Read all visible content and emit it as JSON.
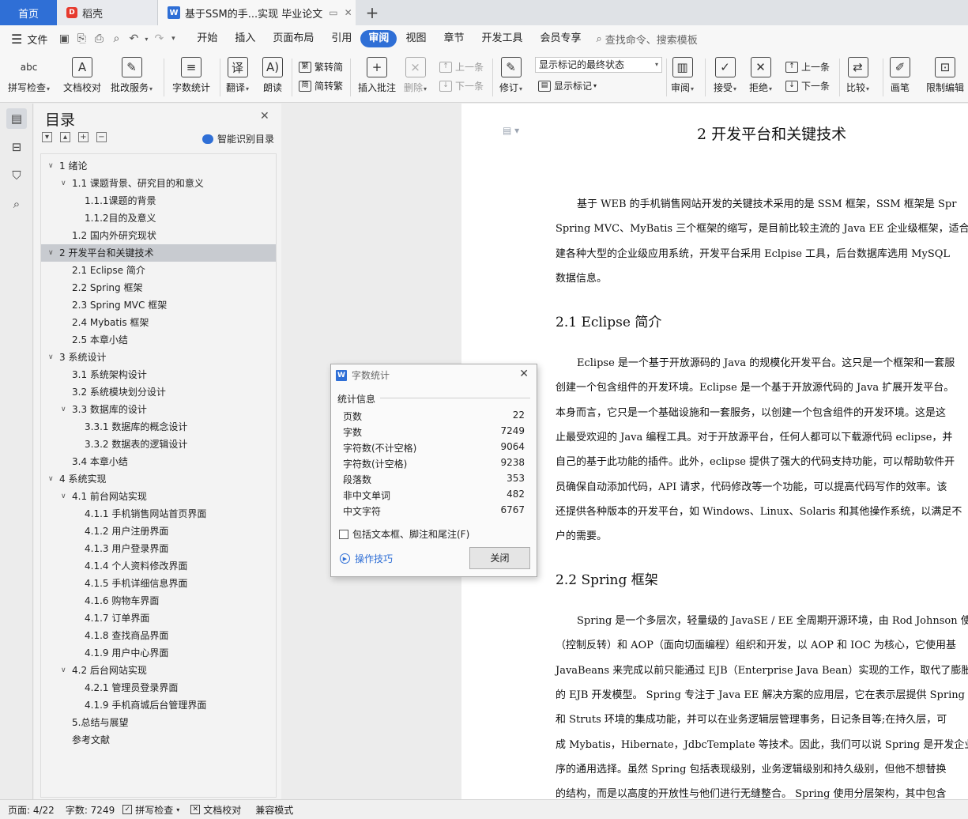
{
  "tabs": {
    "home": "首页",
    "daoke": "稻壳",
    "doc": "基于SSM的手...实现 毕业论文"
  },
  "menu": {
    "file": "文件",
    "items": [
      "开始",
      "插入",
      "页面布局",
      "引用",
      "审阅",
      "视图",
      "章节",
      "开发工具",
      "会员专享"
    ],
    "active": "审阅",
    "search": "查找命令、搜索模板"
  },
  "ribbon": {
    "spell_check": "拼写检查",
    "doc_proof": "文档校对",
    "annot_service": "批改服务",
    "word_count": "字数统计",
    "translate": "翻译",
    "read_aloud": "朗读",
    "trad_to_simp": "繁转简",
    "simp_to_trad": "简转繁",
    "insert_comment": "插入批注",
    "delete": "删除",
    "prev_comment": "上一条",
    "next_comment": "下一条",
    "track": "修订",
    "markup_state": "显示标记的最终状态",
    "show_markup": "显示标记",
    "review": "审阅",
    "accept": "接受",
    "reject": "拒绝",
    "prev_change": "上一条",
    "next_change": "下一条",
    "compare": "比较",
    "pen": "画笔",
    "restrict": "限制编辑",
    "icon_spell_text": "abc"
  },
  "toc": {
    "title": "目录",
    "smart": "智能识别目录",
    "items": [
      {
        "label": "1 绪论",
        "level": 1,
        "expandable": true
      },
      {
        "label": "1.1  课题背景、研究目的和意义",
        "level": 2,
        "expandable": true
      },
      {
        "label": "1.1.1课题的背景",
        "level": 3,
        "expandable": false
      },
      {
        "label": "1.1.2目的及意义",
        "level": 3,
        "expandable": false
      },
      {
        "label": "1.2  国内外研究现状",
        "level": 2,
        "expandable": false
      },
      {
        "label": "2 开发平台和关键技术",
        "level": 1,
        "expandable": true,
        "selected": true
      },
      {
        "label": "2.1 Eclipse 简介",
        "level": 2,
        "expandable": false
      },
      {
        "label": "2.2 Spring 框架",
        "level": 2,
        "expandable": false
      },
      {
        "label": "2.3 Spring MVC 框架",
        "level": 2,
        "expandable": false
      },
      {
        "label": "2.4 Mybatis 框架",
        "level": 2,
        "expandable": false
      },
      {
        "label": "2.5 本章小结",
        "level": 2,
        "expandable": false
      },
      {
        "label": "3 系统设计",
        "level": 1,
        "expandable": true
      },
      {
        "label": "3.1  系统架构设计",
        "level": 2,
        "expandable": false
      },
      {
        "label": "3.2  系统模块划分设计",
        "level": 2,
        "expandable": false
      },
      {
        "label": "3.3  数据库的设计",
        "level": 2,
        "expandable": true
      },
      {
        "label": "3.3.1 数据库的概念设计",
        "level": 3,
        "expandable": false
      },
      {
        "label": "3.3.2  数据表的逻辑设计",
        "level": 3,
        "expandable": false
      },
      {
        "label": "3.4  本章小结",
        "level": 2,
        "expandable": false
      },
      {
        "label": "4 系统实现",
        "level": 1,
        "expandable": true
      },
      {
        "label": "4.1  前台网站实现",
        "level": 2,
        "expandable": true
      },
      {
        "label": "4.1.1  手机销售网站首页界面",
        "level": 3,
        "expandable": false
      },
      {
        "label": "4.1.2  用户注册界面",
        "level": 3,
        "expandable": false
      },
      {
        "label": "4.1.3  用户登录界面",
        "level": 3,
        "expandable": false
      },
      {
        "label": "4.1.4  个人资料修改界面",
        "level": 3,
        "expandable": false
      },
      {
        "label": "4.1.5  手机详细信息界面",
        "level": 3,
        "expandable": false
      },
      {
        "label": "4.1.6  购物车界面",
        "level": 3,
        "expandable": false
      },
      {
        "label": "4.1.7  订单界面",
        "level": 3,
        "expandable": false
      },
      {
        "label": "4.1.8  查找商品界面",
        "level": 3,
        "expandable": false
      },
      {
        "label": "4.1.9  用户中心界面",
        "level": 3,
        "expandable": false
      },
      {
        "label": "4.2 后台网站实现",
        "level": 2,
        "expandable": true
      },
      {
        "label": "4.2.1  管理员登录界面",
        "level": 3,
        "expandable": false
      },
      {
        "label": "4.1.9  手机商城后台管理界面",
        "level": 3,
        "expandable": false
      },
      {
        "label": "5.总结与展望",
        "level": 2,
        "expandable": false
      },
      {
        "label": "参考文献",
        "level": 2,
        "expandable": false
      }
    ]
  },
  "page": {
    "heading": "2 开发平台和关键技术",
    "para1": [
      "基于 WEB 的手机销售网站开发的关键技术采用的是 SSM 框架，SSM 框架是 Spr",
      "Spring MVC、MyBatis 三个框架的缩写，是目前比较主流的 Java EE 企业级框架，适合",
      "建各种大型的企业级应用系统，开发平台采用 Eclpise 工具，后台数据库选用 MySQL",
      "数据信息。"
    ],
    "h21": "2.1 Eclipse 简介",
    "para2": [
      "Eclipse 是一个基于开放源码的 Java 的规模化开发平台。这只是一个框架和一套服",
      "创建一个包含组件的开发环境。Eclipse 是一个基于开放源代码的 Java 扩展开发平台。",
      "本身而言，它只是一个基础设施和一套服务，以创建一个包含组件的开发环境。这是这",
      "止最受欢迎的 Java 编程工具。对于开放源平台，任何人都可以下载源代码 eclipse，并",
      "自己的基于此功能的插件。此外，eclipse 提供了强大的代码支持功能，可以帮助软件开",
      "员确保自动添加代码，API 请求，代码修改等一个功能，可以提高代码写作的效率。该",
      "还提供各种版本的开发平台，如 Windows、Linux、Solaris 和其他操作系统，以满足不",
      "户的需要。"
    ],
    "h22": "2.2 Spring 框架",
    "para3": [
      "Spring 是一个多层次，轻量级的 JavaSE / EE 全周期开源环境，由 Rod Johnson 使用",
      "（控制反转）和 AOP（面向切面编程）组织和开发，以 AOP 和 IOC 为核心，它使用基",
      "JavaBeans 来完成以前只能通过 EJB（Enterprise Java Bean）实现的工作，取代了膨胀，",
      "的 EJB 开发模型。 Spring 专注于 Java EE 解决方案的应用层，它在表示层提供 Spring",
      "和 Struts 环境的集成功能，并可以在业务逻辑层管理事务，日记条目等;在持久层，可",
      "成 Mybatis，Hibernate，JdbcTemplate 等技术。因此，我们可以说 Spring 是开发企业应",
      "序的通用选择。虽然 Spring 包括表现级别，业务逻辑级别和持久级别，但他不想替换",
      "的结构，而是以高度的开放性与他们进行无缝整合。 Spring 使用分层架构，其中包含"
    ]
  },
  "dialog": {
    "title": "字数统计",
    "group": "统计信息",
    "rows": [
      {
        "k": "页数",
        "v": "22"
      },
      {
        "k": "字数",
        "v": "7249"
      },
      {
        "k": "字符数(不计空格)",
        "v": "9064"
      },
      {
        "k": "字符数(计空格)",
        "v": "9238"
      },
      {
        "k": "段落数",
        "v": "353"
      },
      {
        "k": "非中文单词",
        "v": "482"
      },
      {
        "k": "中文字符",
        "v": "6767"
      }
    ],
    "include_text": "包括文本框、脚注和尾注(F)",
    "tips": "操作技巧",
    "close": "关闭"
  },
  "status": {
    "page": "页面: 4/22",
    "words": "字数: 7249",
    "spell": "拼写检查",
    "proof": "文档校对",
    "compat": "兼容模式"
  },
  "colors": {
    "accent": "#2f6fd6",
    "wps_red": "#e63a2e"
  }
}
